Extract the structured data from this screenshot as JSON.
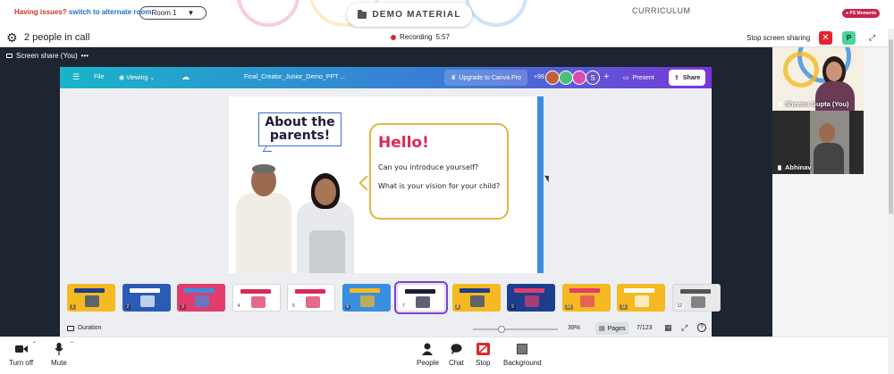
{
  "topbar": {
    "issues_text": "Having issues?",
    "alternate_link": "switch to alternate room",
    "room_label": "Room 1",
    "demo_material": "DEMO MATERIAL",
    "curriculum": "CURRICULUM",
    "ps_moments": "PS Moments"
  },
  "call": {
    "people_count": "2 people in call",
    "recording_label": "Recording",
    "recording_time": "5:57",
    "stop_sharing": "Stop screen sharing",
    "p_badge": "P"
  },
  "share": {
    "label": "Screen share (You)",
    "more": "•••"
  },
  "canva": {
    "file": "File",
    "viewing": "Viewing",
    "doc_title": "Final_Creator_Junior_Demo_PPT ...",
    "upgrade": "Upgrade to Canva Pro",
    "plus99": "+99",
    "avatar_s": "S",
    "present": "Present",
    "share": "Share",
    "duration": "Duration",
    "zoom": "39%",
    "pages": "Pages",
    "page_count": "7/123",
    "colors": {
      "bar_start": "#18b4c8",
      "bar_end": "#7a35d8"
    }
  },
  "slide": {
    "about_title": "About the parents!",
    "hello": "Hello!",
    "question1": "Can you introduce yourself?",
    "question2": "What is your vision for your child?"
  },
  "thumbnails": [
    {
      "num": "1",
      "bg": "#f5b921",
      "accent": "#1d3e8c",
      "light": false
    },
    {
      "num": "2",
      "bg": "#2a5bb5",
      "accent": "#ffffff",
      "light": false
    },
    {
      "num": "3",
      "bg": "#e23c6e",
      "accent": "#3a8ee0",
      "light": false
    },
    {
      "num": "4",
      "bg": "#ffffff",
      "accent": "#d82b57",
      "light": true
    },
    {
      "num": "5",
      "bg": "#ffffff",
      "accent": "#d82b57",
      "light": true
    },
    {
      "num": "6",
      "bg": "#3a8ee0",
      "accent": "#f5b921",
      "light": false
    },
    {
      "num": "7",
      "bg": "#ffffff",
      "accent": "#1b1b3a",
      "light": true,
      "selected": true
    },
    {
      "num": "8",
      "bg": "#f5b921",
      "accent": "#1d3e8c",
      "light": false
    },
    {
      "num": "9",
      "bg": "#1d3e8c",
      "accent": "#e23c6e",
      "light": false
    },
    {
      "num": "10",
      "bg": "#f5b921",
      "accent": "#e23c6e",
      "light": false
    },
    {
      "num": "11",
      "bg": "#f5b921",
      "accent": "#ffffff",
      "light": false
    },
    {
      "num": "12",
      "bg": "#e9e9e9",
      "accent": "#555555",
      "light": true
    }
  ],
  "participants": [
    {
      "name": "Sheenu Gupta (You)"
    },
    {
      "name": "Abhinav"
    }
  ],
  "toolbar": {
    "turn_off": "Turn off",
    "mute": "Mute",
    "people": "People",
    "chat": "Chat",
    "stop": "Stop",
    "background": "Background"
  }
}
